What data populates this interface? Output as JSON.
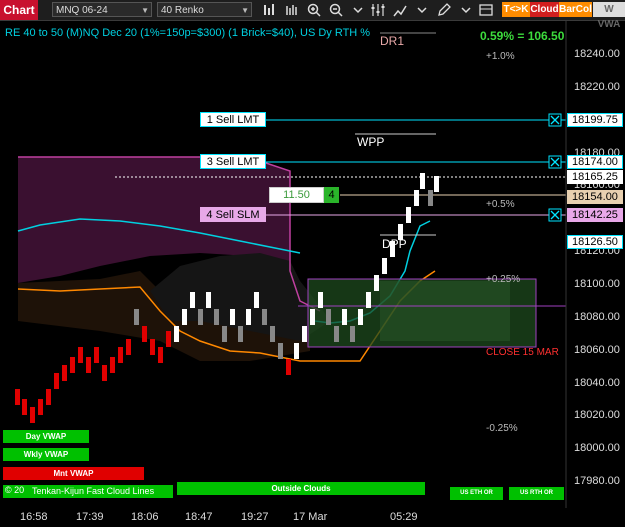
{
  "toolbar": {
    "title": "Chart",
    "instrument": "MNQ 06-24",
    "bar_type": "40 Renko",
    "buttons": {
      "tk": "T<>K",
      "cloud": "Cloud",
      "barcol": "BarCol",
      "vwap": "W VWA"
    },
    "colors": {
      "title_bg": "#c8102e",
      "tk": "#ff8c00",
      "cloud": "#d21f1f",
      "barcol": "#ff8c00"
    }
  },
  "header": {
    "info": "RE 40 to 50 (M)NQ Dec 20 (1%=150p=$300) (1 Brick=$40), US Dy RTH %",
    "change": "0.59% = 106.50"
  },
  "chart_data": {
    "type": "renko",
    "yaxis_ticks": [
      "18240.00",
      "18220.00",
      "18200.00",
      "18180.00",
      "18160.00",
      "18140.00",
      "18120.00",
      "18100.00",
      "18080.00",
      "18060.00",
      "18040.00",
      "18020.00",
      "18000.00",
      "17980.00"
    ],
    "xaxis_ticks": [
      "16:58",
      "17:39",
      "18:06",
      "18:47",
      "19:27",
      "17 Mar",
      "05:29"
    ],
    "price_tags": [
      {
        "text": "18199.75",
        "bg": "#ffffff",
        "fg": "#000000",
        "border": "#00e5ff"
      },
      {
        "text": "18174.00",
        "bg": "#ffffff",
        "fg": "#000000",
        "border": "#00e5ff"
      },
      {
        "text": "18165.25",
        "bg": "#ffffff",
        "fg": "#000000",
        "border": "#ffffff"
      },
      {
        "text": "18154.00",
        "bg": "#e8d0b0",
        "fg": "#000000",
        "border": "#e8d0b0"
      },
      {
        "text": "18142.25",
        "bg": "#e8a8e8",
        "fg": "#000000",
        "border": "#e8a8e8"
      },
      {
        "text": "18126.50",
        "bg": "#ffffff",
        "fg": "#000000",
        "border": "#00e5ff"
      }
    ],
    "orders": [
      {
        "label": "1 Sell LMT",
        "price": 18199.75
      },
      {
        "label": "3 Sell LMT",
        "price": 18174.0
      },
      {
        "label": "4 Sell SLM",
        "price": 18142.25
      }
    ],
    "position": {
      "price": "11.50",
      "qty": "4"
    },
    "levels": [
      {
        "label": "DR1",
        "color": "#e8a8a8"
      },
      {
        "label": "WPP",
        "color": "#ffffff"
      },
      {
        "label": "DPP",
        "color": "#ffffff"
      },
      {
        "label": "CLOSE 15 MAR",
        "color": "#ff3030"
      }
    ],
    "pct_labels": [
      "+1.0%",
      "+0.5%",
      "+0.25%",
      "-0.25%"
    ],
    "bricks_up": [
      [
        10,
        18015
      ],
      [
        10,
        18055
      ],
      [
        10,
        18035
      ],
      [
        10,
        18075
      ],
      [
        10,
        18055
      ],
      [
        10,
        18095
      ],
      [
        10,
        18095
      ],
      [
        10,
        18075
      ],
      [
        10,
        18095
      ],
      [
        10,
        18075
      ],
      [
        10,
        18095
      ],
      [
        10,
        18075
      ],
      [
        10,
        18075
      ],
      [
        10,
        18095
      ],
      [
        10,
        18115
      ],
      [
        10,
        18135
      ],
      [
        10,
        18155
      ],
      [
        10,
        18175
      ]
    ],
    "bricks_down": [
      [
        10,
        18015
      ],
      [
        10,
        18055
      ],
      [
        10,
        18035
      ]
    ]
  },
  "buttons_bottom": [
    {
      "label": "Day VWAP",
      "bg": "#00c000"
    },
    {
      "label": "Wkly VWAP",
      "bg": "#00c000"
    },
    {
      "label": "Mnt VWAP",
      "bg": "#e00000"
    },
    {
      "label": "Outside Clouds",
      "bg": "#00c000"
    },
    {
      "label": "US ETH OR",
      "bg": "#00c000"
    },
    {
      "label": "US RTH OR",
      "bg": "#00c000"
    }
  ],
  "footer_label": "© 20",
  "footer_label2": "Tenkan-Kijun Fast Cloud Lines"
}
